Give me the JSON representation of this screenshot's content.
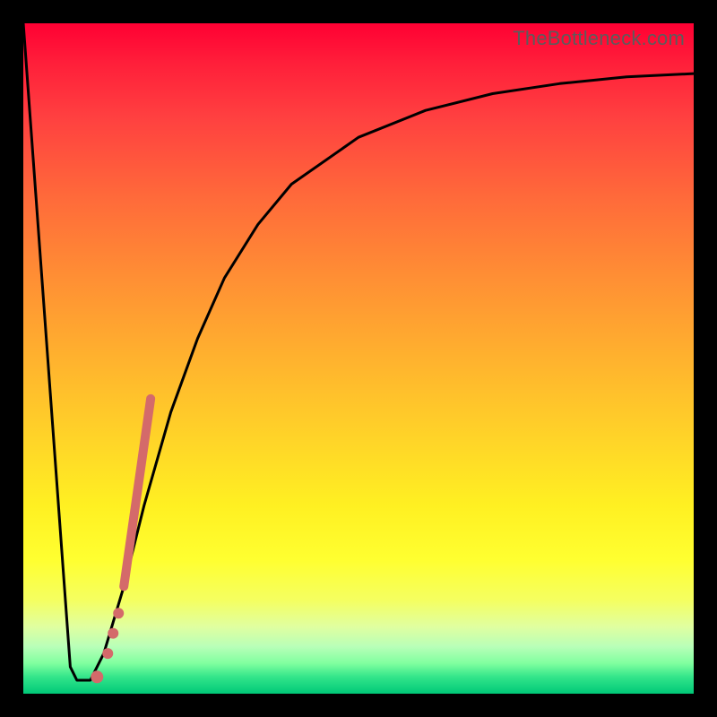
{
  "attribution": "TheBottleneck.com",
  "chart_data": {
    "type": "line",
    "title": "",
    "xlabel": "",
    "ylabel": "",
    "xlim": [
      0,
      100
    ],
    "ylim": [
      0,
      100
    ],
    "series": [
      {
        "name": "bottleneck-curve",
        "x": [
          0,
          7,
          8,
          10,
          12,
          15,
          18,
          22,
          26,
          30,
          35,
          40,
          50,
          60,
          70,
          80,
          90,
          100
        ],
        "values": [
          100,
          4,
          2,
          2,
          6,
          16,
          28,
          42,
          53,
          62,
          70,
          76,
          83,
          87,
          89.5,
          91,
          92,
          92.5
        ]
      }
    ],
    "markers": [
      {
        "name": "highlight-segment",
        "type": "line_segment",
        "x": [
          15,
          19
        ],
        "y": [
          16,
          44
        ],
        "color": "#d46a6a",
        "width": 10
      },
      {
        "name": "dot-1",
        "type": "point",
        "x": 14.2,
        "y": 12,
        "color": "#d46a6a",
        "r": 6
      },
      {
        "name": "dot-2",
        "type": "point",
        "x": 13.4,
        "y": 9,
        "color": "#d46a6a",
        "r": 6
      },
      {
        "name": "dot-3",
        "type": "point",
        "x": 12.6,
        "y": 6,
        "color": "#d46a6a",
        "r": 6
      },
      {
        "name": "dot-4",
        "type": "point",
        "x": 11.0,
        "y": 2.5,
        "color": "#d46a6a",
        "r": 7
      }
    ],
    "background": {
      "type": "vertical_gradient",
      "stops": [
        {
          "pos": 0.0,
          "color": "#ff0033"
        },
        {
          "pos": 0.5,
          "color": "#ffb22e"
        },
        {
          "pos": 0.8,
          "color": "#ffff30"
        },
        {
          "pos": 1.0,
          "color": "#00c878"
        }
      ]
    }
  }
}
